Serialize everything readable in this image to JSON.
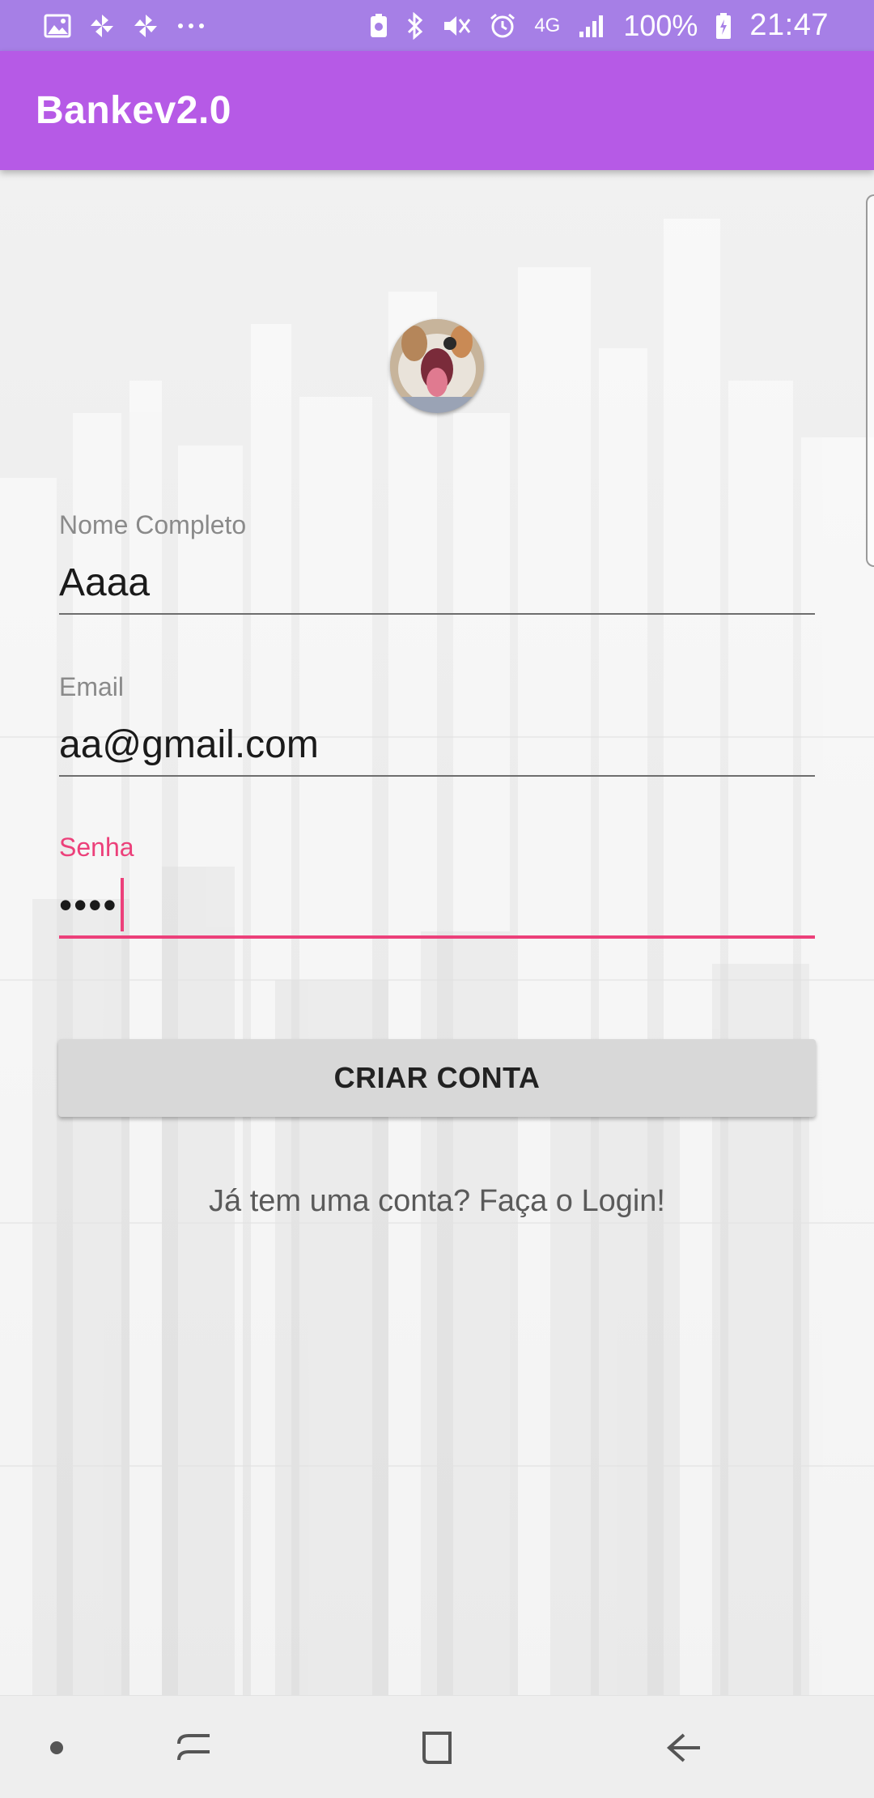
{
  "status_bar": {
    "time": "21:47",
    "battery_percent": "100%",
    "network": "4G",
    "left_icons": [
      "gallery-icon",
      "pinwheel-icon",
      "pinwheel-icon",
      "more-dots-icon"
    ],
    "right_icons": [
      "nfc-icon",
      "bluetooth-icon",
      "mute-icon",
      "alarm-icon",
      "data-arrows-icon",
      "signal-icon",
      "battery-icon"
    ]
  },
  "app_bar": {
    "title": "Bankev2.0",
    "color": "#b65ae6"
  },
  "form": {
    "name_field": {
      "label": "Nome Completo",
      "value": "Aaaa"
    },
    "email_field": {
      "label": "Email",
      "value": "aa@gmail.com"
    },
    "password_field": {
      "label": "Senha",
      "value": "••••",
      "accent_color": "#ec407a"
    },
    "submit_label": "CRIAR CONTA",
    "login_link": "Já tem uma conta? Faça o Login!"
  },
  "nav_bar": {
    "items": [
      "dot-icon",
      "recents-icon",
      "home-icon",
      "back-icon"
    ]
  }
}
